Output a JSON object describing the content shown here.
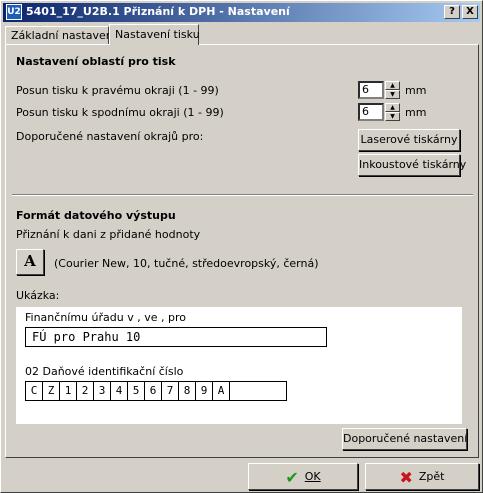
{
  "window": {
    "title": "5401_17_U2B.1 Přiznání k DPH - Nastavení",
    "icon_text": "U2",
    "help_btn": "?",
    "close_btn": "X"
  },
  "tabs": [
    "Základní nastavení",
    "Nastavení tisku"
  ],
  "print_margins": {
    "heading": "Nastavení oblastí pro tisk",
    "right_label": "Posun tisku k pravému okraji (1 - 99)",
    "right_value": "6",
    "bottom_label": "Posun tisku k spodnímu okraji (1 - 99)",
    "bottom_value": "6",
    "unit": "mm",
    "recommended_label": "Doporučené nastavení okrajů pro:",
    "laser_btn": "Laserové tiskárny",
    "inkjet_btn": "Inkoustové tiskárny"
  },
  "output_format": {
    "heading": "Formát datového výstupu",
    "subtitle": "Přiznání k dani z přidané hodnoty",
    "font_btn": "A",
    "font_desc": "(Courier New, 10, tučné, středoevropský, černá)"
  },
  "sample": {
    "label": "Ukázka:",
    "office_caption": "Finančnímu úřadu v , ve , pro",
    "office_value": "FÚ pro Prahu 10",
    "dic_caption": "02 Daňové identifikační číslo",
    "dic_chars": [
      "C",
      "Z",
      "1",
      "2",
      "3",
      "4",
      "5",
      "6",
      "7",
      "8",
      "9",
      "A",
      ""
    ]
  },
  "recommended_btn": "Doporučené nastavení",
  "footer": {
    "ok": "OK",
    "back": "Zpět"
  },
  "spin_arrows": {
    "up": "▲",
    "down": "▼"
  }
}
